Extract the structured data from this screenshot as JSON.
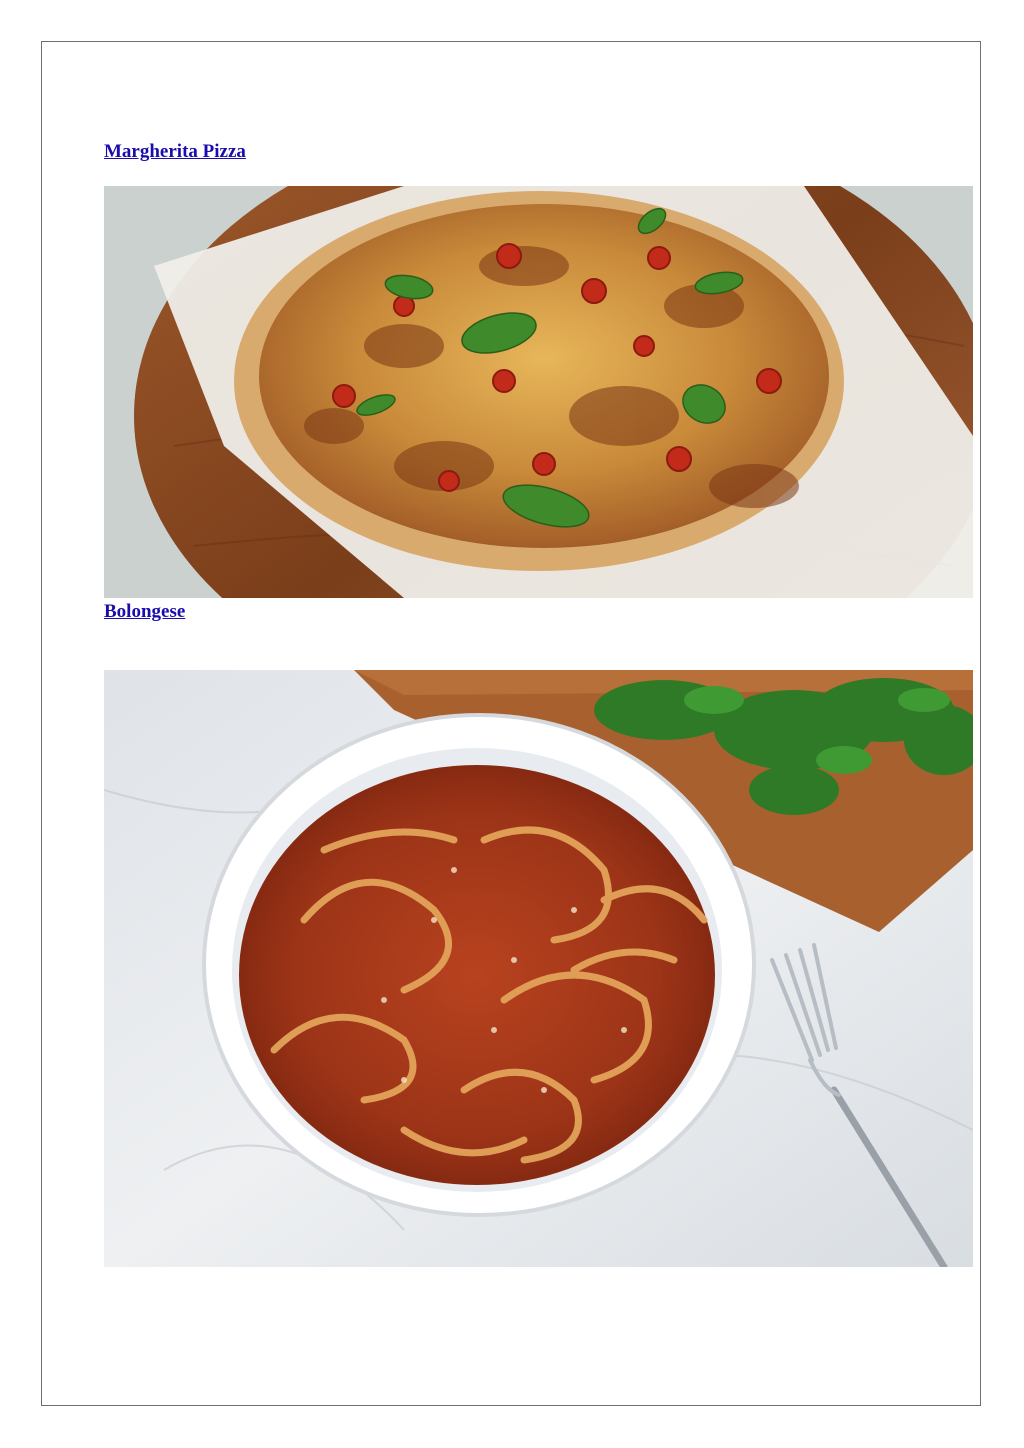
{
  "recipes": [
    {
      "title": "Margherita Pizza"
    },
    {
      "title": "Bolongese"
    }
  ],
  "colors": {
    "link": "#1a0dab",
    "frame": "#6f6f6f",
    "wood": "#8a4a22",
    "tomato_sauce": "#a8301a",
    "basil": "#3f8a2a",
    "marble": "#e8ebee"
  }
}
